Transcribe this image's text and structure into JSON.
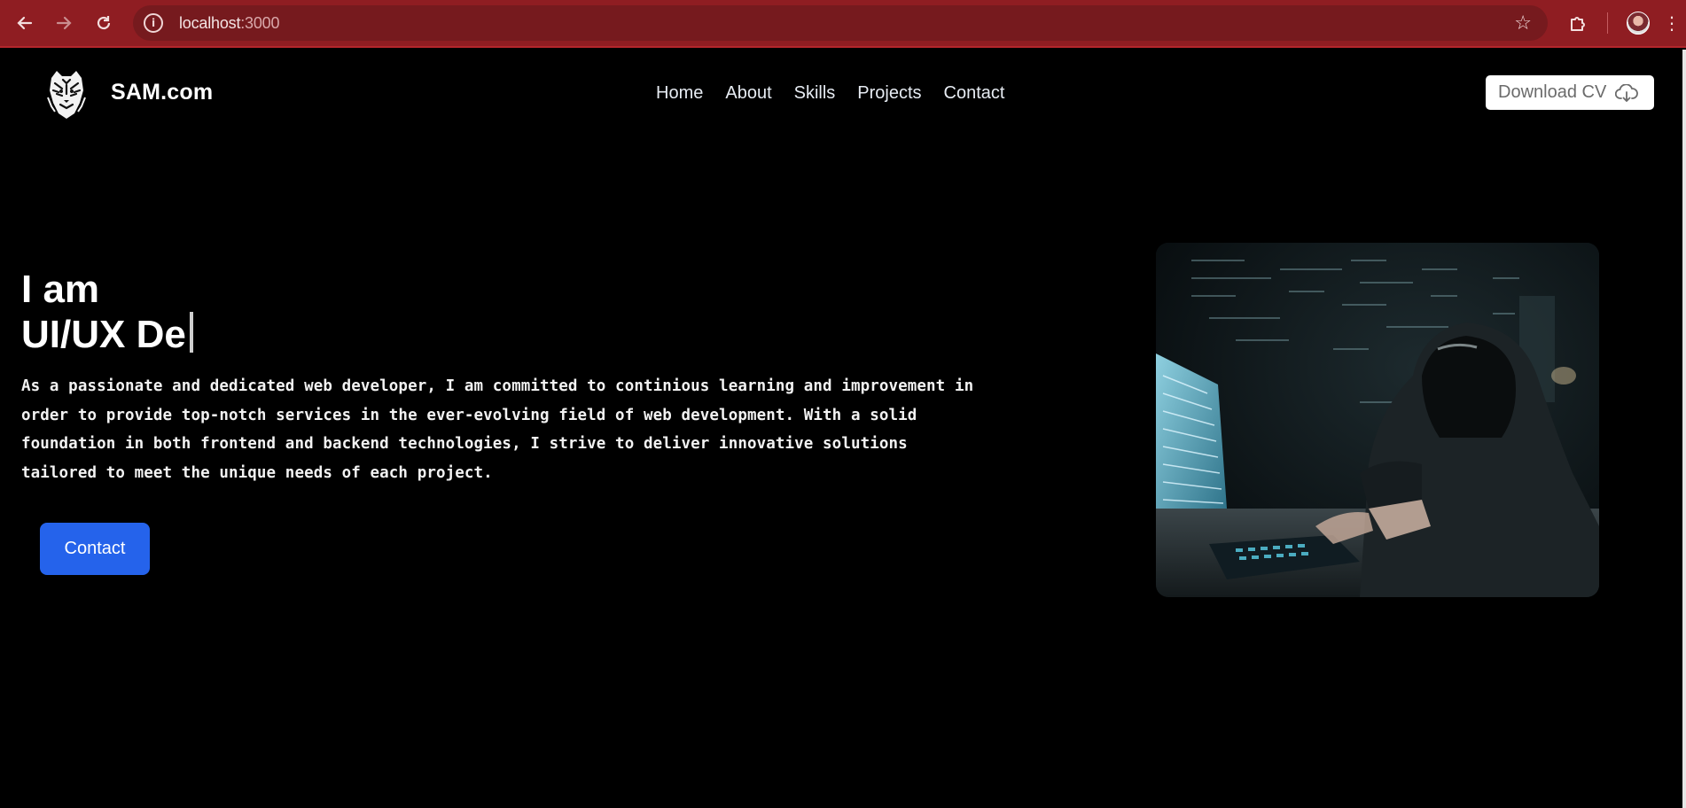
{
  "browser": {
    "url_host": "localhost",
    "url_port": ":3000"
  },
  "header": {
    "brand": "SAM.com",
    "nav": [
      "Home",
      "About",
      "Skills",
      "Projects",
      "Contact"
    ],
    "download_cv_label": "Download CV"
  },
  "hero": {
    "line1": "I am",
    "line2": "UI/UX De",
    "description": "As a passionate and dedicated web developer, I am committed to continious learning and improvement in order to provide top-notch services in the ever-evolving field of web development. With a solid foundation in both frontend and backend technologies, I strive to deliver innovative solutions tailored to meet the unique needs of each project.",
    "contact_label": "Contact"
  },
  "colors": {
    "chrome": "#8f1d22",
    "accent": "#2563eb",
    "page_bg": "#000000"
  },
  "icons": {
    "back": "arrow-left-icon",
    "forward": "arrow-right-icon",
    "reload": "reload-icon",
    "site_info": "info-icon",
    "bookmark": "star-icon",
    "extensions": "puzzle-icon",
    "menu": "kebab-menu-icon",
    "download": "cloud-download-icon",
    "logo": "tiger-logo-icon"
  }
}
